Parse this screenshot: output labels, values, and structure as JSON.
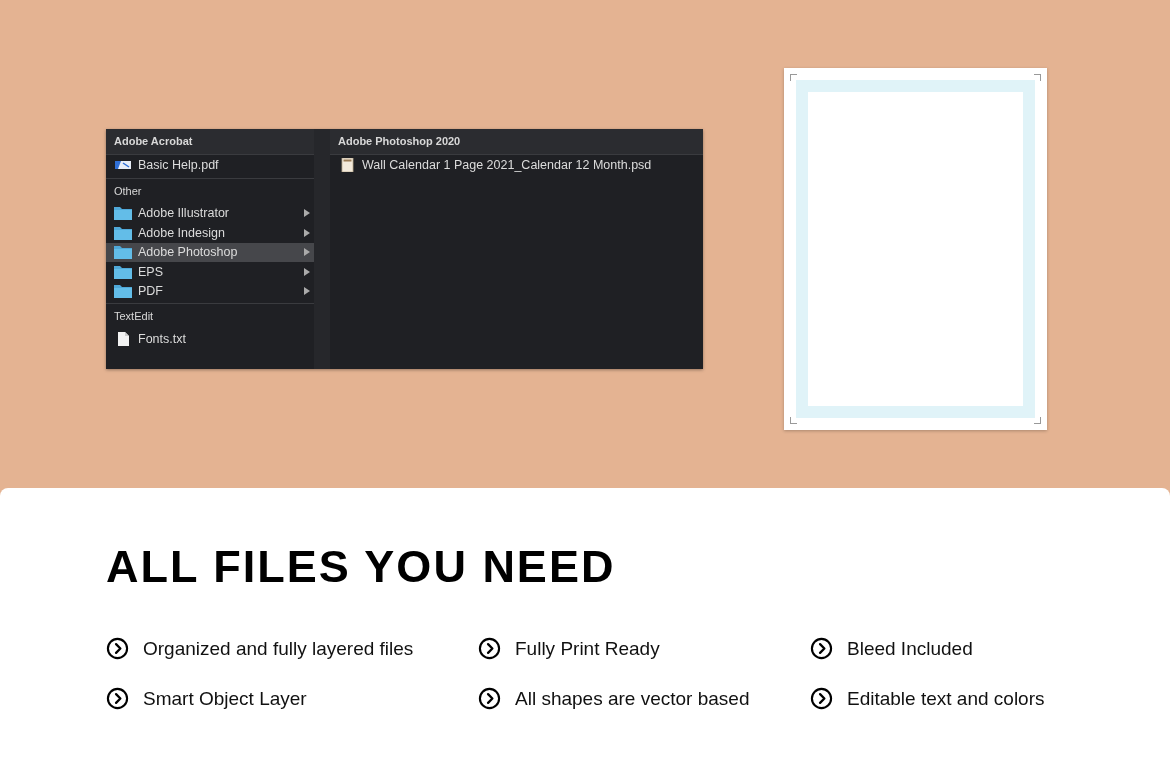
{
  "menu": {
    "sections": [
      {
        "header": "Adobe Acrobat",
        "items": [
          {
            "label": "Basic Help.pdf",
            "kind": "pdf",
            "selected": false,
            "has_submenu": false
          }
        ]
      },
      {
        "header": "Other",
        "items": [
          {
            "label": "Adobe Illustrator",
            "kind": "folder",
            "selected": false,
            "has_submenu": true
          },
          {
            "label": "Adobe Indesign",
            "kind": "folder",
            "selected": false,
            "has_submenu": true
          },
          {
            "label": "Adobe Photoshop",
            "kind": "folder",
            "selected": true,
            "has_submenu": true
          },
          {
            "label": "EPS",
            "kind": "folder",
            "selected": false,
            "has_submenu": true
          },
          {
            "label": "PDF",
            "kind": "folder",
            "selected": false,
            "has_submenu": true
          }
        ]
      },
      {
        "header": "TextEdit",
        "items": [
          {
            "label": "Fonts.txt",
            "kind": "txt",
            "selected": false,
            "has_submenu": false
          }
        ]
      }
    ]
  },
  "submenu": {
    "header": "Adobe Photoshop 2020",
    "items": [
      {
        "label": "Wall Calendar 1 Page 2021_Calendar 12 Month.psd",
        "kind": "psd"
      }
    ]
  },
  "heading": "ALL FILES YOU NEED",
  "features": [
    {
      "label": "Organized and fully layered files"
    },
    {
      "label": "Fully Print Ready"
    },
    {
      "label": "Bleed Included"
    },
    {
      "label": "Smart Object Layer"
    },
    {
      "label": "All shapes are vector based"
    },
    {
      "label": "Editable text and colors"
    }
  ]
}
